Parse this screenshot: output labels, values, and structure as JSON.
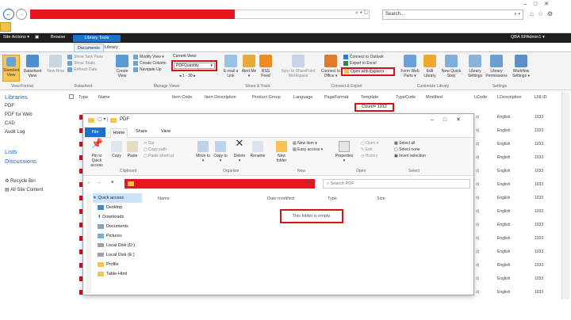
{
  "browser": {
    "search_placeholder": "Search...",
    "search_icon": "magnifier-icon",
    "window_controls": [
      "–",
      "□",
      "✕"
    ]
  },
  "sharepoint": {
    "top_bar": {
      "site_actions": "Site Actions ▾",
      "browse": "Browse",
      "user": "QBA SPAdmin1 ▾"
    },
    "context_label": "Library Tools",
    "tabs": [
      "Documents",
      "Library"
    ],
    "ribbon": {
      "standard_view": "Standard View",
      "datasheet_view": "Datasheet View",
      "new_row": "New Row",
      "show_task_pane": "Show Task Pane",
      "show_totals": "Show Totals",
      "refresh_data": "Refresh Data",
      "create_view": "Create View",
      "modify_view": "Modify View ▾",
      "create_column": "Create Column",
      "navigate_up": "Navigate Up",
      "current_view_label": "Current View:",
      "current_view_value": "PDFQuantity",
      "paging": "◂  1 - 30  ▸",
      "email_link": "E-mail a Link",
      "alert_me": "Alert Me ▾",
      "rss_feed": "RSS Feed",
      "sync_sp": "Sync to SharePoint Workspace",
      "connect_office": "Connect to Office ▾",
      "connect_outlook": "Connect to Outlook",
      "export_excel": "Export to Excel",
      "open_explorer": "Open with Explorer",
      "form_web_parts": "Form Web Parts ▾",
      "edit_library": "Edit Library",
      "new_quick_step": "New Quick Step",
      "library_settings": "Library Settings",
      "library_permissions": "Library Permissions",
      "workflow_settings": "Workflow Settings ▾",
      "groups": [
        "View Format",
        "Datasheet",
        "Manage Views",
        "Share & Track",
        "Connect & Export",
        "Customize Library",
        "Settings"
      ]
    },
    "nav": {
      "libraries_heading": "Libraries",
      "libraries": [
        "PDF",
        "PDF for Web",
        "CAD",
        "Audit Log"
      ],
      "lists_heading": "Lists",
      "discussions": "Discussions",
      "recycle_bin": "Recycle Bin",
      "all_site_content": "All Site Content"
    },
    "columns": [
      "Type",
      "Name",
      "Item Code",
      "Item Description",
      "Product Group",
      "Language",
      "PageFormat",
      "Template",
      "TypeCode",
      "Modified",
      "LCode",
      "LDescription",
      "LNLID"
    ],
    "count_label": "Count= 1312",
    "row_values": {
      "lcode": "dj",
      "ldesc": "English",
      "lnlid": "1033"
    },
    "row_count": 14
  },
  "explorer": {
    "title": "PDF",
    "tabs": [
      "File",
      "Home",
      "Share",
      "View"
    ],
    "ribbon": {
      "pin": "Pin to Quick access",
      "copy": "Copy",
      "paste": "Paste",
      "cut": "Cut",
      "copy_path": "Copy path",
      "paste_shortcut": "Paste shortcut",
      "move_to": "Move to ▾",
      "copy_to": "Copy to ▾",
      "delete": "Delete ▾",
      "rename": "Rename",
      "new_folder": "New folder",
      "new_item": "New item ▾",
      "easy_access": "Easy access ▾",
      "properties": "Properties ▾",
      "open": "Open ▾",
      "edit": "Edit",
      "history": "History",
      "select_all": "Select all",
      "select_none": "Select none",
      "invert_selection": "Invert selection",
      "groups": [
        "Clipboard",
        "Organize",
        "New",
        "Open",
        "Select"
      ]
    },
    "search_placeholder": "Search PDF",
    "sidebar": [
      "Quick access",
      "Desktop",
      "Downloads",
      "Documents",
      "Pictures",
      "Local Disk (D:)",
      "Local Disk (E:)",
      "Profile",
      "Table-Html"
    ],
    "columns": [
      "Name",
      "Date modified",
      "Type",
      "Size"
    ],
    "empty_message": "This folder is empty."
  },
  "colors": {
    "accent": "#1a73c8",
    "highlight": "#d4121a",
    "redacted": "#e8141e"
  }
}
